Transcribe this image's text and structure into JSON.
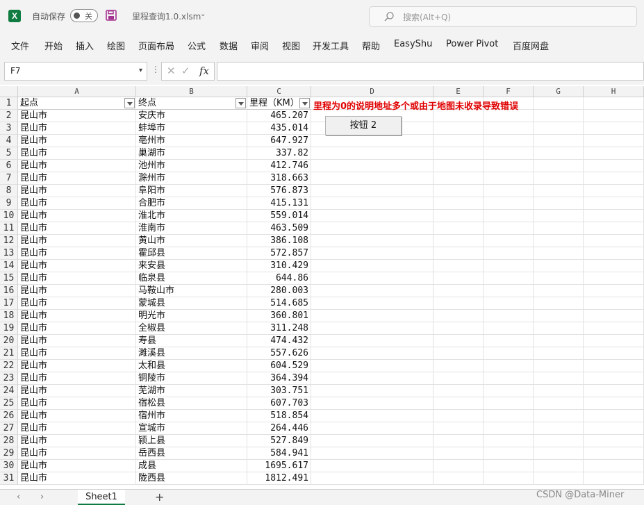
{
  "titlebar": {
    "app_icon": "excel-icon",
    "autosave_label": "自动保存",
    "autosave_state": "关",
    "file_name": "里程查询1.0.xlsm",
    "search_placeholder": "搜索(Alt+Q)"
  },
  "ribbon": {
    "tabs": [
      "文件",
      "开始",
      "插入",
      "绘图",
      "页面布局",
      "公式",
      "数据",
      "审阅",
      "视图",
      "开发工具",
      "帮助",
      "EasyShu",
      "Power Pivot",
      "百度网盘"
    ]
  },
  "formula_bar": {
    "name_box": "F7",
    "fx_label": "fx",
    "formula": ""
  },
  "grid": {
    "columns": [
      "A",
      "B",
      "C",
      "D",
      "E",
      "F",
      "G",
      "H"
    ],
    "header_row": {
      "a": "起点",
      "b": "终点",
      "c": "里程（KM）"
    },
    "note": "里程为0的说明地址多个或由于地图未收录导致错误",
    "button_label": "按钮 2",
    "rows": [
      {
        "n": "1"
      },
      {
        "n": "2",
        "a": "昆山市",
        "b": "安庆市",
        "c": "465.207"
      },
      {
        "n": "3",
        "a": "昆山市",
        "b": "蚌埠市",
        "c": "435.014"
      },
      {
        "n": "4",
        "a": "昆山市",
        "b": "亳州市",
        "c": "647.927"
      },
      {
        "n": "5",
        "a": "昆山市",
        "b": "巢湖市",
        "c": "337.82"
      },
      {
        "n": "6",
        "a": "昆山市",
        "b": "池州市",
        "c": "412.746"
      },
      {
        "n": "7",
        "a": "昆山市",
        "b": "滁州市",
        "c": "318.663"
      },
      {
        "n": "8",
        "a": "昆山市",
        "b": "阜阳市",
        "c": "576.873"
      },
      {
        "n": "9",
        "a": "昆山市",
        "b": "合肥市",
        "c": "415.131"
      },
      {
        "n": "10",
        "a": "昆山市",
        "b": "淮北市",
        "c": "559.014"
      },
      {
        "n": "11",
        "a": "昆山市",
        "b": "淮南市",
        "c": "463.509"
      },
      {
        "n": "12",
        "a": "昆山市",
        "b": "黄山市",
        "c": "386.108"
      },
      {
        "n": "13",
        "a": "昆山市",
        "b": "霍邱县",
        "c": "572.857"
      },
      {
        "n": "14",
        "a": "昆山市",
        "b": "来安县",
        "c": "310.429"
      },
      {
        "n": "15",
        "a": "昆山市",
        "b": "临泉县",
        "c": "644.86"
      },
      {
        "n": "16",
        "a": "昆山市",
        "b": "马鞍山市",
        "c": "280.003"
      },
      {
        "n": "17",
        "a": "昆山市",
        "b": "蒙城县",
        "c": "514.685"
      },
      {
        "n": "18",
        "a": "昆山市",
        "b": "明光市",
        "c": "360.801"
      },
      {
        "n": "19",
        "a": "昆山市",
        "b": "全椒县",
        "c": "311.248"
      },
      {
        "n": "20",
        "a": "昆山市",
        "b": "寿县",
        "c": "474.432"
      },
      {
        "n": "21",
        "a": "昆山市",
        "b": "濉溪县",
        "c": "557.626"
      },
      {
        "n": "22",
        "a": "昆山市",
        "b": "太和县",
        "c": "604.529"
      },
      {
        "n": "23",
        "a": "昆山市",
        "b": "铜陵市",
        "c": "364.394"
      },
      {
        "n": "24",
        "a": "昆山市",
        "b": "芜湖市",
        "c": "303.751"
      },
      {
        "n": "25",
        "a": "昆山市",
        "b": "宿松县",
        "c": "607.703"
      },
      {
        "n": "26",
        "a": "昆山市",
        "b": "宿州市",
        "c": "518.854"
      },
      {
        "n": "27",
        "a": "昆山市",
        "b": "宣城市",
        "c": "264.446"
      },
      {
        "n": "28",
        "a": "昆山市",
        "b": "颍上县",
        "c": "527.849"
      },
      {
        "n": "29",
        "a": "昆山市",
        "b": "岳西县",
        "c": "584.941"
      },
      {
        "n": "30",
        "a": "昆山市",
        "b": "成县",
        "c": "1695.617"
      },
      {
        "n": "31",
        "a": "昆山市",
        "b": "陇西县",
        "c": "1812.491"
      }
    ]
  },
  "sheets": {
    "prev": "‹",
    "next": "›",
    "active": "Sheet1",
    "add": "+"
  },
  "watermark": "CSDN @Data-Miner"
}
